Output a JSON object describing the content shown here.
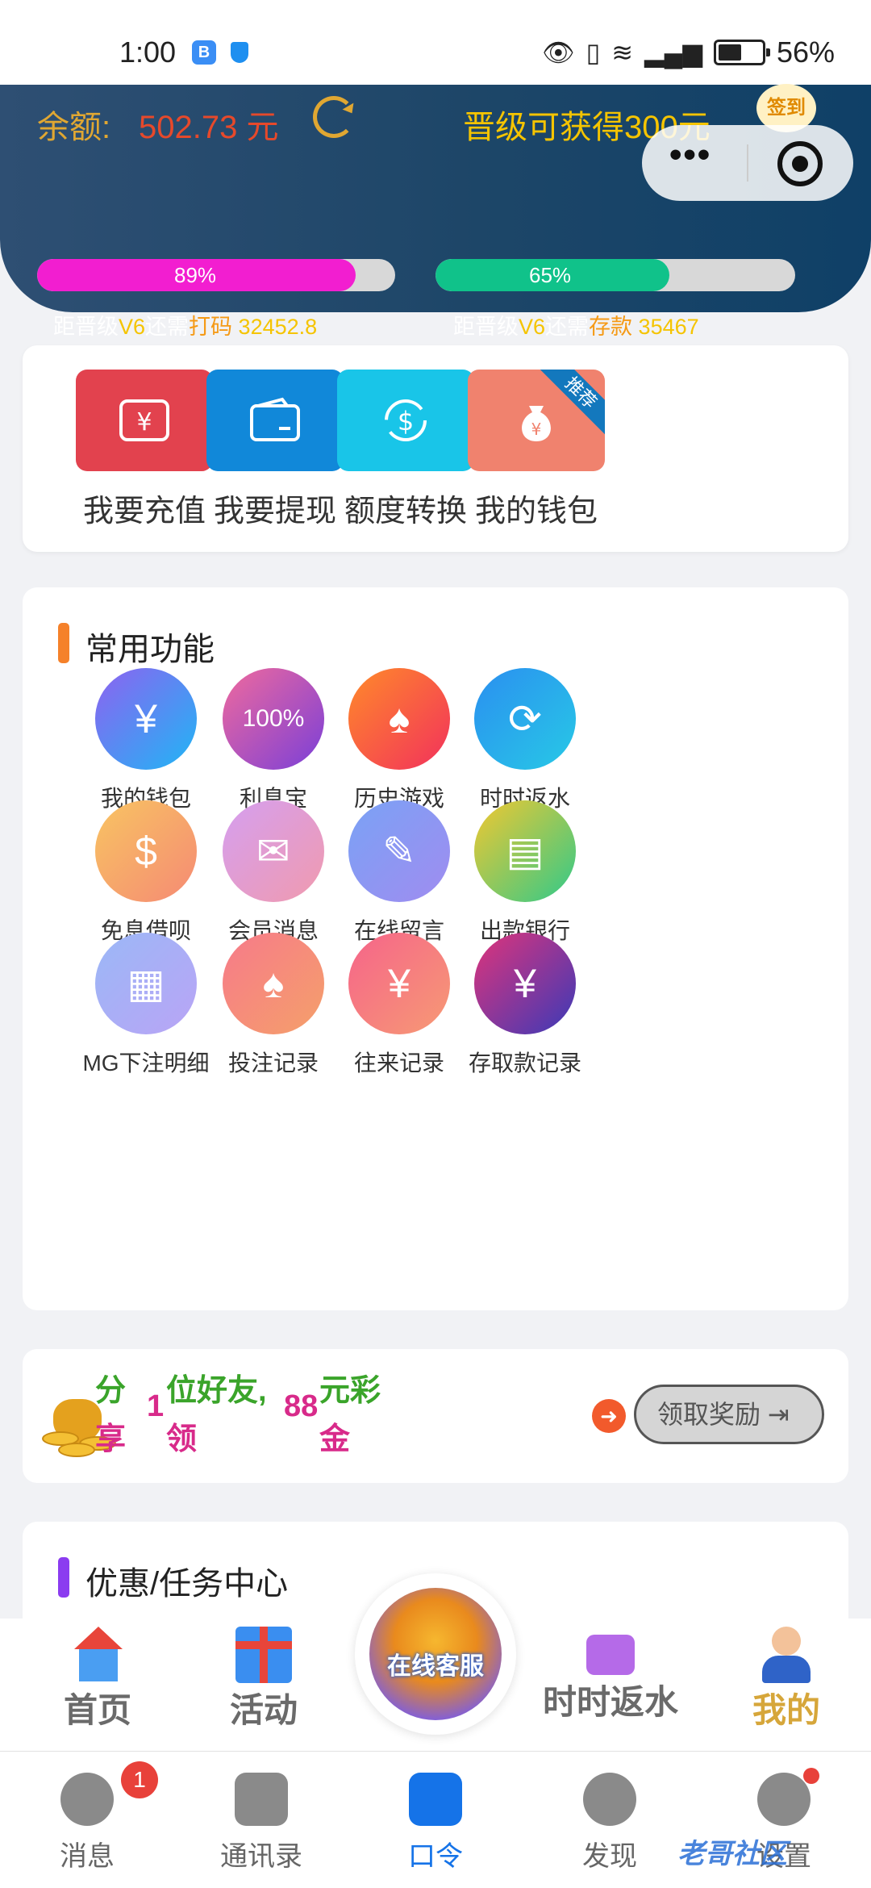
{
  "status_bar": {
    "time": "1:00",
    "battery": "56%",
    "icons": [
      "eye-icon",
      "vibrate-icon",
      "wifi-icon",
      "signal-icon",
      "battery-icon"
    ]
  },
  "header": {
    "balance_label": "余额:",
    "balance_value": "502.73 元",
    "promo_text": "晋级可获得300元",
    "signin_label": "签到",
    "bar1_percent": "89%",
    "bar1_fraction": 0.89,
    "bar2_percent": "65%",
    "bar2_fraction": 0.65,
    "need1": {
      "prefix": "距晋级",
      "level": "V6",
      "middle": "还需",
      "kind": "打码",
      "amount": "32452.8"
    },
    "need2": {
      "prefix": "距晋级",
      "level": "V6",
      "middle": "还需",
      "kind": "存款",
      "amount": "35467"
    }
  },
  "quick_actions": [
    {
      "label": "我要充值",
      "icon": "recharge-icon"
    },
    {
      "label": "我要提现",
      "icon": "wallet-icon"
    },
    {
      "label": "额度转换",
      "icon": "exchange-icon"
    },
    {
      "label": "我的钱包",
      "icon": "money-bag-icon",
      "ribbon": "推荐"
    }
  ],
  "functions": {
    "title": "常用功能",
    "accent": "#f5812a",
    "items": [
      {
        "label": "我的钱包",
        "icon": "money-bag-icon",
        "glyph": "¥",
        "colors": [
          "#8e62f0",
          "#1fb6f5"
        ]
      },
      {
        "label": "利息宝",
        "icon": "interest-bag-icon",
        "glyph": "100%",
        "colors": [
          "#f06a9d",
          "#7a3fd8"
        ]
      },
      {
        "label": "历史游戏",
        "icon": "cards-icon",
        "glyph": "♠",
        "colors": [
          "#ff8a2a",
          "#f2315c"
        ]
      },
      {
        "label": "时时返水",
        "icon": "cycle-icon",
        "glyph": "⟳",
        "colors": [
          "#2a8ff0",
          "#28c9e6"
        ]
      },
      {
        "label": "免息借呗",
        "icon": "loan-hand-icon",
        "glyph": "$",
        "colors": [
          "#f8c462",
          "#f58a74"
        ]
      },
      {
        "label": "会员消息",
        "icon": "mail-icon",
        "glyph": "✉",
        "colors": [
          "#d59ff0",
          "#f09aae"
        ]
      },
      {
        "label": "在线留言",
        "icon": "edit-icon",
        "glyph": "✎",
        "colors": [
          "#7aa2f5",
          "#a08cf0"
        ]
      },
      {
        "label": "出款银行",
        "icon": "bank-card-icon",
        "glyph": "▤",
        "colors": [
          "#f2c830",
          "#30c98a"
        ]
      },
      {
        "label": "MG下注明细",
        "icon": "report-icon",
        "glyph": "▦",
        "colors": [
          "#9bb8f7",
          "#b9a4f5"
        ]
      },
      {
        "label": "投注记录",
        "icon": "cards-icon",
        "glyph": "♠",
        "colors": [
          "#f67a8a",
          "#f5a06a"
        ]
      },
      {
        "label": "往来记录",
        "icon": "clipboard-icon",
        "glyph": "¥",
        "colors": [
          "#f5648a",
          "#f79a74"
        ]
      },
      {
        "label": "存取款记录",
        "icon": "clipboard-yen-icon",
        "glyph": "¥",
        "colors": [
          "#e0347a",
          "#3a3ab8"
        ]
      }
    ]
  },
  "share": {
    "t1": "分",
    "t2": "享",
    "num1": "1",
    "t3": "位好友,",
    "t4": "领",
    "num2": "88",
    "t5": "元彩",
    "t6": "金",
    "button": "领取奖励"
  },
  "promo_section": {
    "title": "优惠/任务中心",
    "accent": "#8b3cf0"
  },
  "float_nav": {
    "home": "首页",
    "activity": "活动",
    "service": "在线客服",
    "rebate": "时时返水",
    "mine": "我的"
  },
  "tabbar": {
    "tabs": [
      {
        "label": "消息",
        "icon": "chat-icon",
        "badge": "1"
      },
      {
        "label": "通讯录",
        "icon": "contacts-icon"
      },
      {
        "label": "口令",
        "icon": "key-icon",
        "active": true
      },
      {
        "label": "发现",
        "icon": "compass-icon"
      },
      {
        "label": "设置",
        "icon": "gear-icon"
      }
    ]
  },
  "watermark": "老哥社区"
}
